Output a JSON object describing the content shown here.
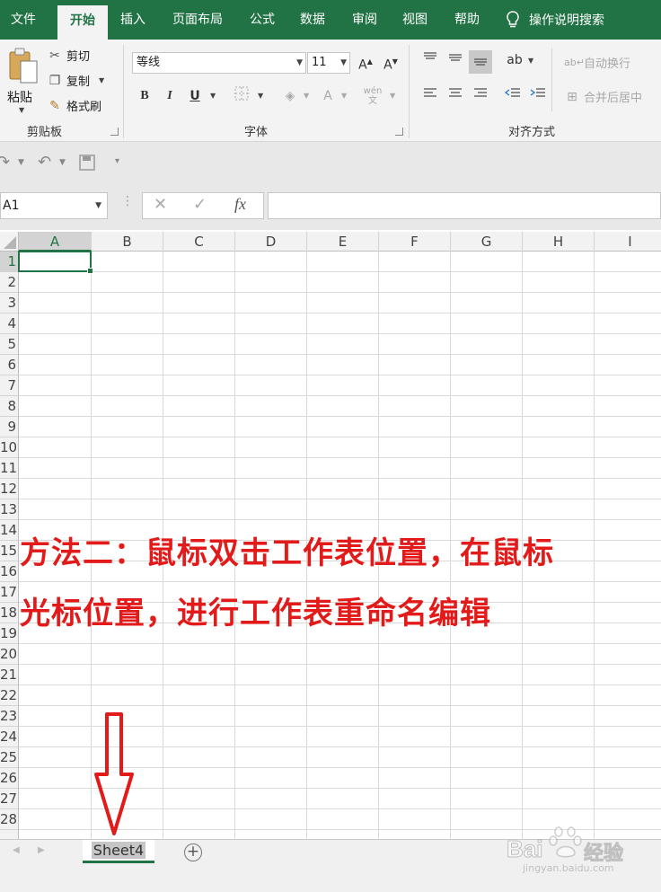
{
  "tabs": [
    {
      "label": "文件",
      "x": 0
    },
    {
      "label": "开始",
      "active": true
    },
    {
      "label": "插入"
    },
    {
      "label": "页面布局"
    },
    {
      "label": "公式"
    },
    {
      "label": "数据"
    },
    {
      "label": "审阅"
    },
    {
      "label": "视图"
    },
    {
      "label": "帮助"
    }
  ],
  "tell_me": "操作说明搜索",
  "clipboard": {
    "paste": "粘贴",
    "cut": "剪切",
    "copy": "复制",
    "format_painter": "格式刷",
    "group_label": "剪贴板"
  },
  "font": {
    "name": "等线",
    "size": "11",
    "group_label": "字体"
  },
  "alignment": {
    "wrap_text": "自动换行",
    "merge_center": "合并后居中",
    "group_label": "对齐方式"
  },
  "name_box": "A1",
  "columns": [
    "A",
    "B",
    "C",
    "D",
    "E",
    "F",
    "G",
    "H",
    "I"
  ],
  "rows": [
    "1",
    "2",
    "3",
    "4",
    "5",
    "6",
    "7",
    "8",
    "9",
    "10",
    "11",
    "12",
    "13",
    "14",
    "15",
    "16",
    "17",
    "18",
    "19",
    "20",
    "21",
    "22",
    "23",
    "24",
    "25",
    "26",
    "27",
    "28"
  ],
  "annotation": {
    "line1": "方法二：鼠标双击工作表位置，在鼠标",
    "line2": "光标位置，进行工作表重命名编辑"
  },
  "sheet_tab": "Sheet4",
  "watermark": {
    "brand": "Bai",
    "brand2": "经验",
    "url": "jingyan.baidu.com"
  },
  "colors": {
    "excel_green": "#217346",
    "annotation_red": "#e21a1a"
  }
}
